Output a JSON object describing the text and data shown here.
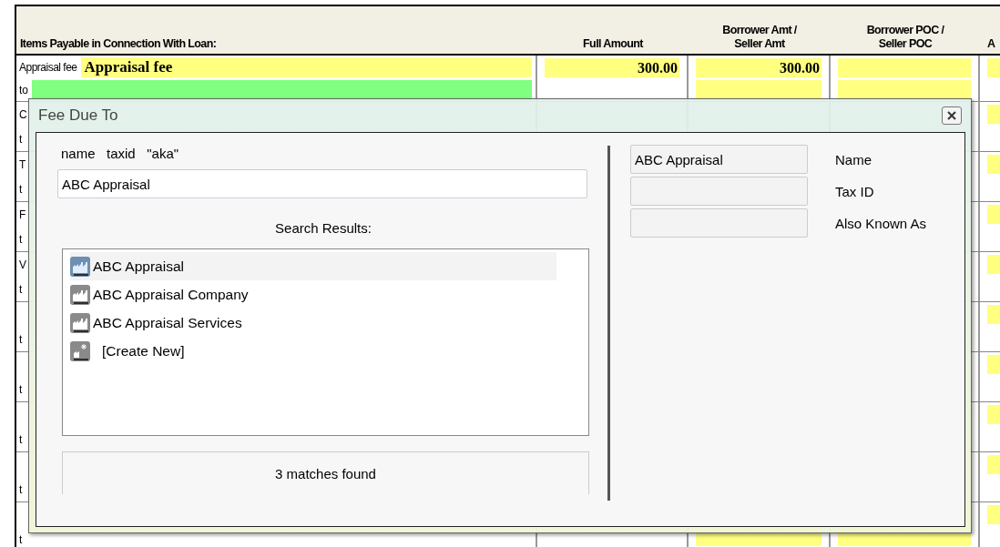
{
  "form": {
    "columns": [
      {
        "lines": [
          "Items Payable in Connection With Loan:"
        ]
      },
      {
        "lines": [
          "Full Amount"
        ]
      },
      {
        "lines": [
          "Borrower Amt /",
          "Seller Amt"
        ]
      },
      {
        "lines": [
          "Borrower POC /",
          "Seller POC"
        ]
      },
      {
        "lines": [
          "A"
        ]
      }
    ],
    "rows": [
      {
        "code": "Appraisal fee",
        "description": "Appraisal fee",
        "payee_prefix": "to",
        "full_amount": "300.00",
        "borrower_amount": "300.00"
      },
      {
        "code": "C",
        "payee_prefix": "t"
      },
      {
        "code": "T",
        "payee_prefix": "t"
      },
      {
        "code": "F",
        "payee_prefix": "t"
      },
      {
        "code": "V",
        "payee_prefix": "t"
      },
      {
        "payee_prefix": "t"
      },
      {
        "payee_prefix": "t"
      },
      {
        "payee_prefix": "t"
      },
      {
        "payee_prefix": "t"
      },
      {
        "payee_prefix": "t"
      }
    ]
  },
  "dialog": {
    "title": "Fee Due To",
    "search_hint": "name   taxid   \"aka\"",
    "search": {
      "value": "ABC Appraisal"
    },
    "results_label": "Search Results:",
    "results": [
      {
        "kind": "company",
        "label": "ABC Appraisal",
        "selected": true
      },
      {
        "kind": "company",
        "label": "ABC Appraisal Company",
        "selected": false
      },
      {
        "kind": "company",
        "label": "ABC Appraisal Services",
        "selected": false
      },
      {
        "kind": "create",
        "label": "[Create New]",
        "selected": false
      }
    ],
    "status": "3 matches found",
    "details": [
      {
        "label": "Name",
        "value": "ABC Appraisal"
      },
      {
        "label": "Tax ID"
      },
      {
        "label": "Also Known As"
      }
    ]
  }
}
